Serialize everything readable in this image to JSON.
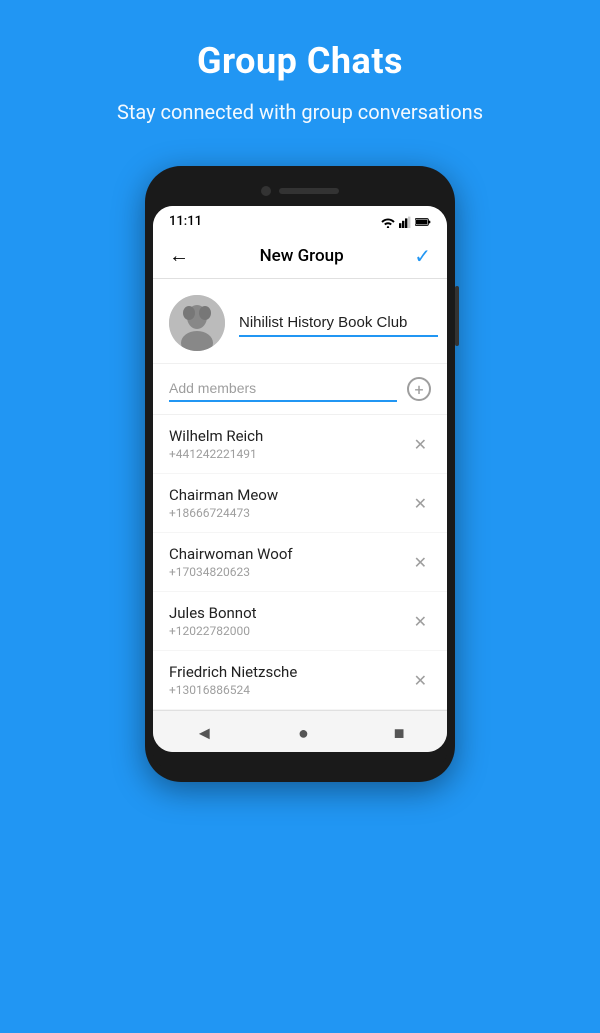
{
  "header": {
    "title": "Group Chats",
    "subtitle": "Stay connected with group conversations"
  },
  "status_bar": {
    "time": "11:11",
    "wifi": "▼",
    "signal": "▲",
    "battery": "▮"
  },
  "toolbar": {
    "title": "New Group",
    "back_label": "←",
    "confirm_label": "✓"
  },
  "group": {
    "name_placeholder": "Nihilist History Book Club",
    "name_value": "Nihilist History Book Club"
  },
  "add_members": {
    "placeholder": "Add members"
  },
  "members": [
    {
      "name": "Wilhelm Reich",
      "phone": "+441242221491"
    },
    {
      "name": "Chairman Meow",
      "phone": "+18666724473"
    },
    {
      "name": "Chairwoman Woof",
      "phone": "+17034820623"
    },
    {
      "name": "Jules Bonnot",
      "phone": "+12022782000"
    },
    {
      "name": "Friedrich Nietzsche",
      "phone": "+13016886524"
    }
  ],
  "nav": {
    "back": "◄",
    "home": "●",
    "recents": "■"
  }
}
